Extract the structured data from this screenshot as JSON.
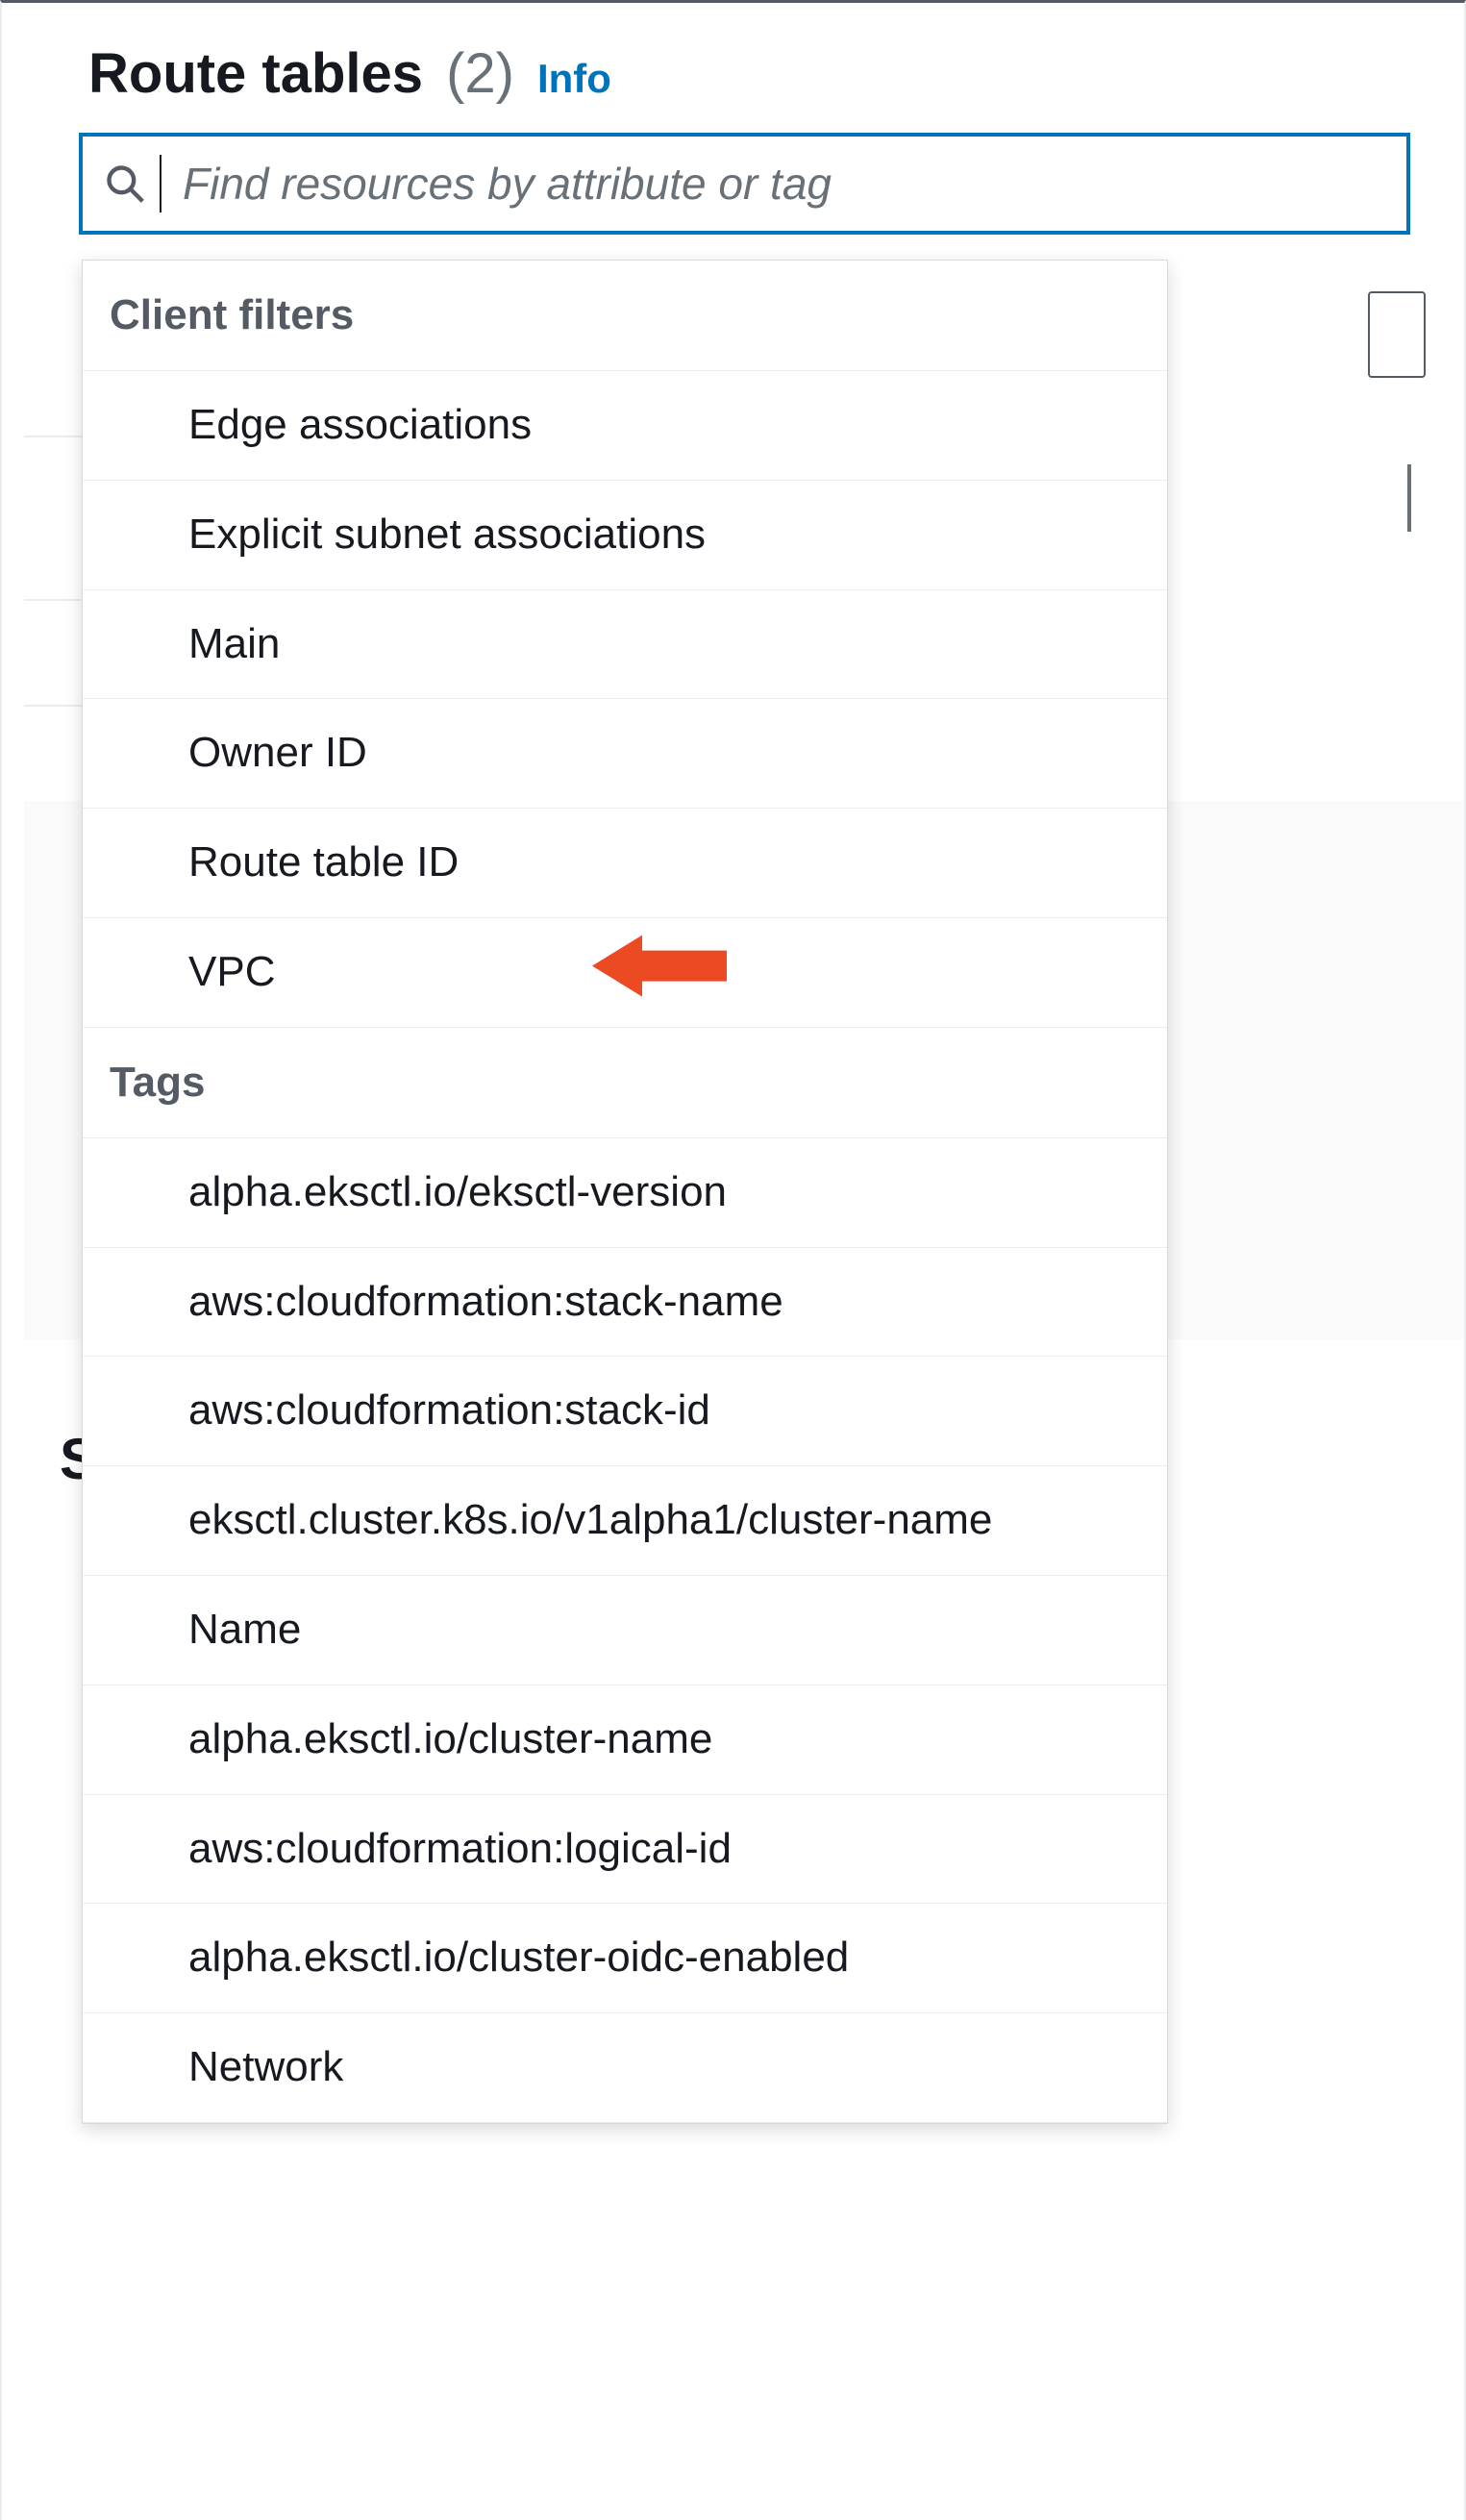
{
  "header": {
    "title": "Route tables",
    "count_display": "(2)",
    "info_label": "Info"
  },
  "search": {
    "placeholder": "Find resources by attribute or tag",
    "value": ""
  },
  "dropdown": {
    "groups": [
      {
        "label": "Client filters",
        "options": [
          {
            "label": "Edge associations"
          },
          {
            "label": "Explicit subnet associations"
          },
          {
            "label": "Main"
          },
          {
            "label": "Owner ID"
          },
          {
            "label": "Route table ID"
          },
          {
            "label": "VPC",
            "highlighted": true
          }
        ]
      },
      {
        "label": "Tags",
        "options": [
          {
            "label": "alpha.eksctl.io/eksctl-version"
          },
          {
            "label": "aws:cloudformation:stack-name"
          },
          {
            "label": "aws:cloudformation:stack-id"
          },
          {
            "label": "eksctl.cluster.k8s.io/v1alpha1/cluster-name"
          },
          {
            "label": "Name"
          },
          {
            "label": "alpha.eksctl.io/cluster-name"
          },
          {
            "label": "aws:cloudformation:logical-id"
          },
          {
            "label": "alpha.eksctl.io/cluster-oidc-enabled"
          },
          {
            "label": "Network"
          }
        ]
      }
    ]
  },
  "annotations": {
    "arrow_color": "#ec4a23"
  }
}
